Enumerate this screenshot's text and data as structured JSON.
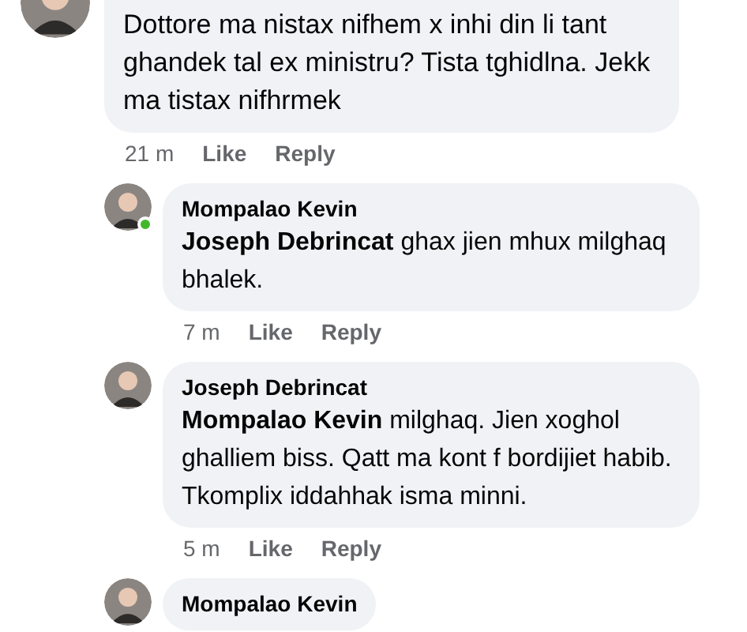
{
  "comments": [
    {
      "text": "Dottore ma nistax nifhem x inhi din li tant ghandek tal ex ministru? Tista tghidlna. Jekk ma tistax nifhrmek",
      "time": "21 m",
      "like": "Like",
      "reply": "Reply",
      "online": false,
      "children": [
        {
          "author": "Mompalao Kevin",
          "text": "**Joseph Debrincat** ghax jien mhux milghaq bhalek.",
          "time": "7 m",
          "like": "Like",
          "reply": "Reply",
          "online": true
        },
        {
          "author": "Joseph Debrincat",
          "text": "**Mompalao Kevin** milghaq. Jien xoghol ghalliem biss. Qatt ma kont f bordijiet habib. Tkomplix iddahhak isma minni.",
          "time": "5 m",
          "like": "Like",
          "reply": "Reply",
          "online": false
        },
        {
          "author": "Mompalao Kevin",
          "online": false
        }
      ]
    }
  ]
}
